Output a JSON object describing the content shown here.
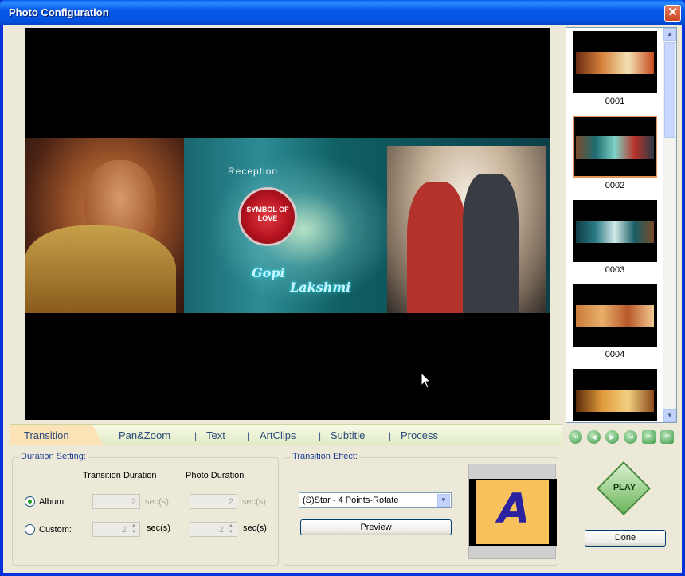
{
  "window": {
    "title": "Photo Configuration",
    "close_glyph": "✕"
  },
  "preview": {
    "reception_text": "Reception",
    "emblem_text": "SYMBOL OF LOVE",
    "name_left": "Gopi",
    "name_right": "Lakshmi"
  },
  "thumbnails": [
    {
      "label": "0001",
      "selected": false
    },
    {
      "label": "0002",
      "selected": true
    },
    {
      "label": "0003",
      "selected": false
    },
    {
      "label": "0004",
      "selected": false
    },
    {
      "label": "",
      "selected": false
    }
  ],
  "nav_icons": [
    "first-icon",
    "previous-icon",
    "next-icon",
    "last-icon",
    "rotate-right-icon",
    "rotate-left-icon"
  ],
  "tabs": [
    {
      "label": "Transition",
      "active": true
    },
    {
      "label": "Pan&Zoom",
      "active": false
    },
    {
      "label": "Text",
      "active": false
    },
    {
      "label": "ArtClips",
      "active": false
    },
    {
      "label": "Subtitle",
      "active": false
    },
    {
      "label": "Process",
      "active": false
    }
  ],
  "duration": {
    "group_title": "Duration Setting:",
    "col_transition": "Transition Duration",
    "col_photo": "Photo Duration",
    "album_label": "Album:",
    "custom_label": "Custom:",
    "album_selected": true,
    "album_transition_value": "2",
    "album_photo_value": "2",
    "custom_transition_value": "2",
    "custom_photo_value": "2",
    "unit": "sec(s)"
  },
  "effect": {
    "group_title": "Transition Effect:",
    "selected": "(S)Star - 4 Points-Rotate",
    "preview_button": "Preview",
    "preview_letter": "A"
  },
  "actions": {
    "play_label": "PLAY",
    "done_label": "Done"
  }
}
